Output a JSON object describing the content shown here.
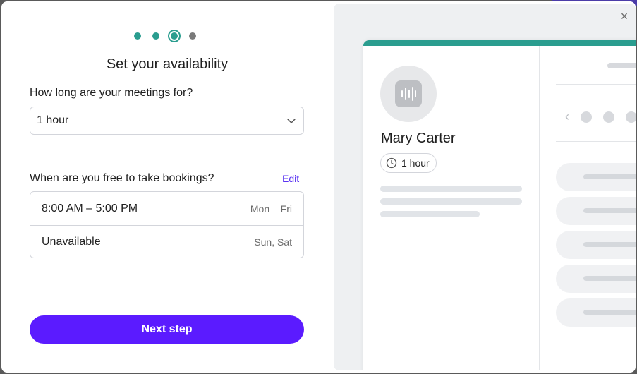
{
  "stepper": {
    "steps": [
      "done",
      "done",
      "current",
      "todo"
    ]
  },
  "title": "Set your availability",
  "duration": {
    "label": "How long are your meetings for?",
    "value": "1 hour"
  },
  "availability": {
    "label": "When are you free to take bookings?",
    "edit_label": "Edit",
    "rows": [
      {
        "time": "8:00 AM – 5:00 PM",
        "days": "Mon – Fri"
      },
      {
        "time": "Unavailable",
        "days": "Sun, Sat"
      }
    ]
  },
  "next_button_label": "Next step",
  "close_icon": "×",
  "preview": {
    "host_name": "Mary Carter",
    "duration_chip": "1 hour",
    "accent_color": "#2a9d8f"
  },
  "colors": {
    "primary": "#5b1bff",
    "accent": "#2a9d8f",
    "link": "#5b34f2"
  }
}
